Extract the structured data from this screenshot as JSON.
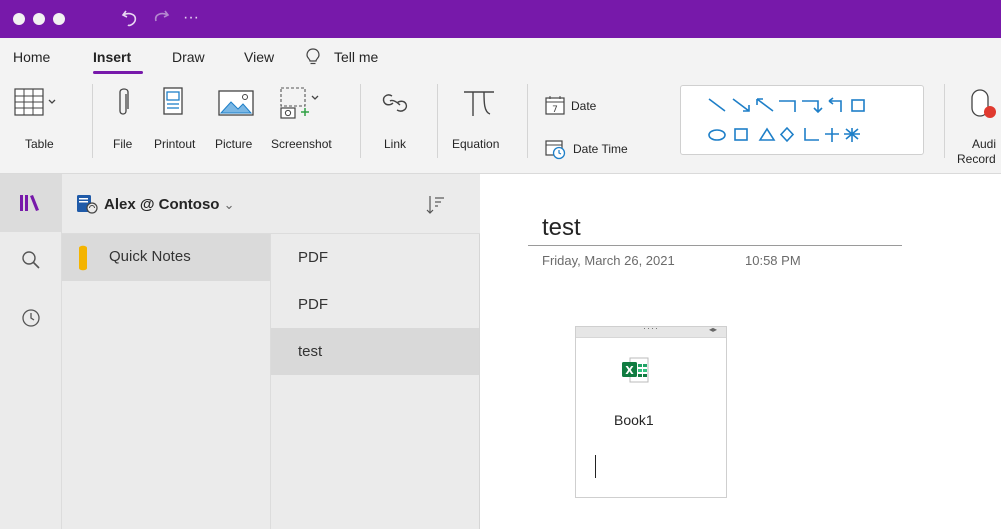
{
  "titlebar": {
    "undo_icon": "undo-icon",
    "redo_icon": "redo-icon",
    "more_label": "···",
    "bg_color": "#7719aa"
  },
  "tabs": [
    {
      "label": "Home"
    },
    {
      "label": "Insert"
    },
    {
      "label": "Draw"
    },
    {
      "label": "View"
    },
    {
      "label": "Tell me"
    }
  ],
  "ribbon": {
    "table": "Table",
    "file": "File",
    "printout": "Printout",
    "picture": "Picture",
    "screenshot": "Screenshot",
    "link": "Link",
    "equation": "Equation",
    "date": "Date",
    "date_time": "Date  Time",
    "audio": "Audi",
    "audio_line2": "Record"
  },
  "notebook": {
    "name": "Alex @ Contoso"
  },
  "sections": [
    {
      "label": "Quick Notes",
      "color": "#f4b400"
    }
  ],
  "pages": [
    {
      "label": "PDF"
    },
    {
      "label": "PDF"
    },
    {
      "label": "test"
    }
  ],
  "page": {
    "title": "test",
    "date": "Friday, March 26, 2021",
    "time": "10:58 PM",
    "attachment": {
      "name": "Book1",
      "icon": "excel-file-icon"
    }
  },
  "accent_color": "#7719aa"
}
